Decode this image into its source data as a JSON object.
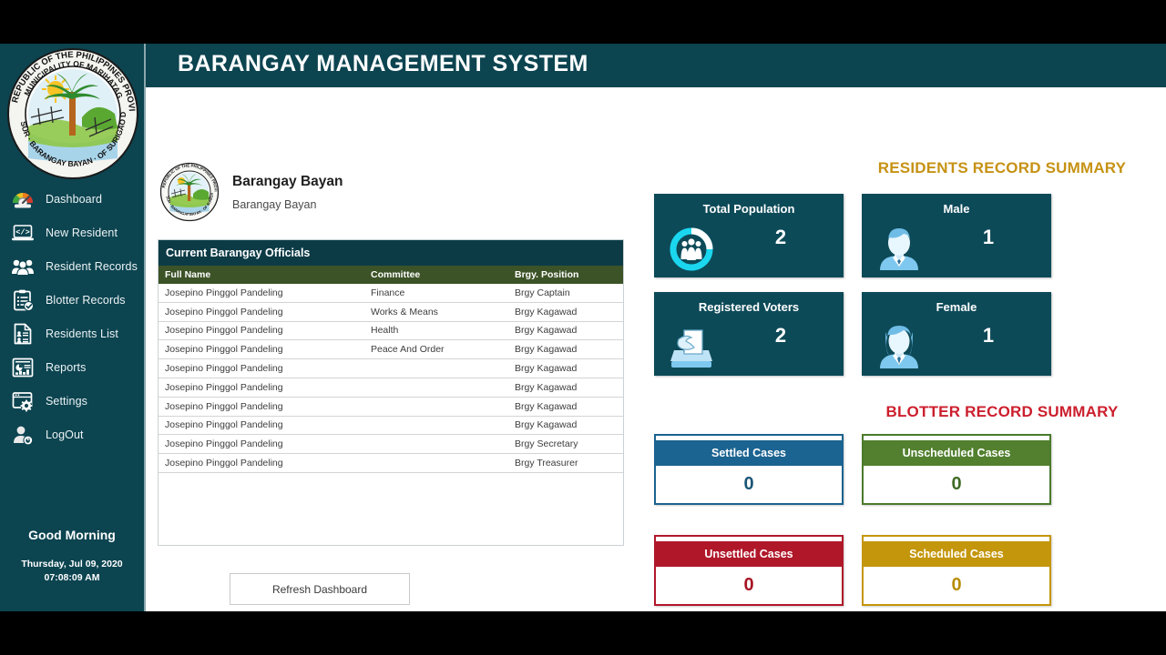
{
  "header": {
    "title": "BARANGAY MANAGEMENT SYSTEM"
  },
  "sidebar": {
    "items": [
      {
        "label": "Dashboard",
        "icon": "speedometer-icon"
      },
      {
        "label": "New Resident",
        "icon": "laptop-code-icon"
      },
      {
        "label": "Resident Records",
        "icon": "people-group-icon"
      },
      {
        "label": "Blotter Records",
        "icon": "clipboard-check-icon"
      },
      {
        "label": "Residents List",
        "icon": "document-person-icon"
      },
      {
        "label": "Reports",
        "icon": "report-chart-icon"
      },
      {
        "label": "Settings",
        "icon": "window-gear-icon"
      },
      {
        "label": "LogOut",
        "icon": "user-power-icon"
      }
    ],
    "greeting": "Good Morning",
    "date": "Thursday, Jul 09,  2020",
    "time": "07:08:09 AM"
  },
  "barangay": {
    "name": "Barangay Bayan",
    "subtitle": "Barangay Bayan"
  },
  "officials": {
    "panel_title": "Current Barangay Officials",
    "columns": [
      "Full Name",
      "Committee",
      "Brgy. Position"
    ],
    "rows": [
      {
        "name": "Josepino Pinggol Pandeling",
        "committee": "Finance",
        "position": "Brgy Captain"
      },
      {
        "name": "Josepino Pinggol Pandeling",
        "committee": "Works & Means",
        "position": "Brgy Kagawad"
      },
      {
        "name": "Josepino Pinggol Pandeling",
        "committee": "Health",
        "position": "Brgy Kagawad"
      },
      {
        "name": "Josepino Pinggol Pandeling",
        "committee": "Peace And Order",
        "position": "Brgy Kagawad"
      },
      {
        "name": "Josepino Pinggol Pandeling",
        "committee": "",
        "position": "Brgy Kagawad"
      },
      {
        "name": "Josepino Pinggol Pandeling",
        "committee": "",
        "position": "Brgy Kagawad"
      },
      {
        "name": "Josepino Pinggol Pandeling",
        "committee": "",
        "position": "Brgy Kagawad"
      },
      {
        "name": "Josepino Pinggol Pandeling",
        "committee": "",
        "position": "Brgy Kagawad"
      },
      {
        "name": "Josepino Pinggol Pandeling",
        "committee": "",
        "position": "Brgy Secretary"
      },
      {
        "name": "Josepino Pinggol Pandeling",
        "committee": "",
        "position": "Brgy Treasurer"
      }
    ]
  },
  "actions": {
    "refresh_label": "Refresh Dashboard"
  },
  "residents_summary": {
    "title": "RESIDENTS RECORD SUMMARY",
    "title_color": "#c69214",
    "cards": [
      {
        "label": "Total Population",
        "value": "2",
        "icon": "people-ring-icon"
      },
      {
        "label": "Male",
        "value": "1",
        "icon": "male-avatar-icon"
      },
      {
        "label": "Registered Voters",
        "value": "2",
        "icon": "ballot-box-icon"
      },
      {
        "label": "Female",
        "value": "1",
        "icon": "female-avatar-icon"
      }
    ]
  },
  "blotter_summary": {
    "title": "BLOTTER  RECORD SUMMARY",
    "title_color": "#cc1f2e",
    "cards": [
      {
        "label": "Settled Cases",
        "value": "0",
        "color": "#1b6390"
      },
      {
        "label": "Unscheduled Cases",
        "value": "0",
        "color": "#4a7a2b"
      },
      {
        "label": "Unsettled Cases",
        "value": "0",
        "color": "#b0182a"
      },
      {
        "label": "Scheduled Cases",
        "value": "0",
        "color": "#c4960b"
      }
    ]
  }
}
